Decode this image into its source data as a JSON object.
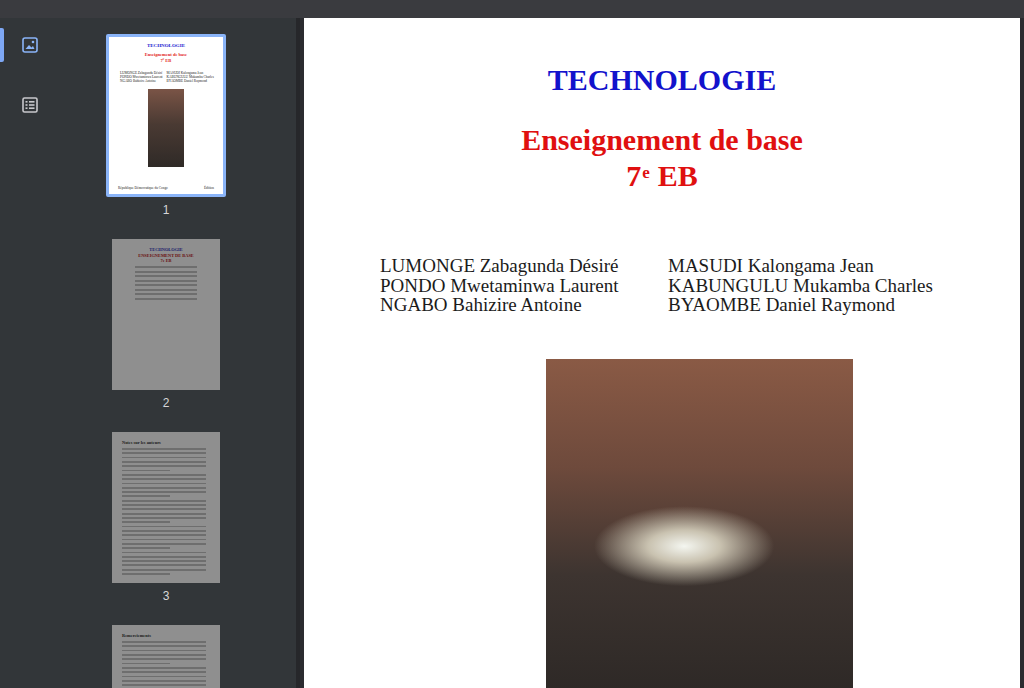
{
  "sidebar_tools": [
    {
      "kind": "thumbnails",
      "selected": true
    },
    {
      "kind": "outline",
      "selected": false
    }
  ],
  "thumbnails": [
    {
      "page": "1",
      "selected": true,
      "kind": "cover",
      "footer": [
        "République Démocratique du Congo",
        "Édition"
      ]
    },
    {
      "page": "2",
      "selected": false,
      "kind": "title-page",
      "headings": [
        "TECHNOLOGIE",
        "ENSEIGNEMENT DE BASE",
        "7e EB"
      ]
    },
    {
      "page": "3",
      "selected": false,
      "kind": "text-page",
      "headings": [
        "Notes sur les auteurs"
      ]
    },
    {
      "page": "4",
      "selected": false,
      "kind": "text-page",
      "headings": [
        "Remerciements"
      ]
    }
  ],
  "document": {
    "title": "TECHNOLOGIE",
    "subtitle": "Enseignement de base",
    "grade": "7",
    "grade_sup": "e",
    "grade_rest": "EB",
    "authors": [
      [
        "LUMONGE Zabagunda Désiré",
        "PONDO Mwetaminwa Laurent",
        "NGABO Bahizire Antoine"
      ],
      [
        "MASUDI Kalongama Jean",
        "KABUNGULU Mukamba Charles",
        "BYAOMBE Daniel Raymond"
      ]
    ]
  }
}
